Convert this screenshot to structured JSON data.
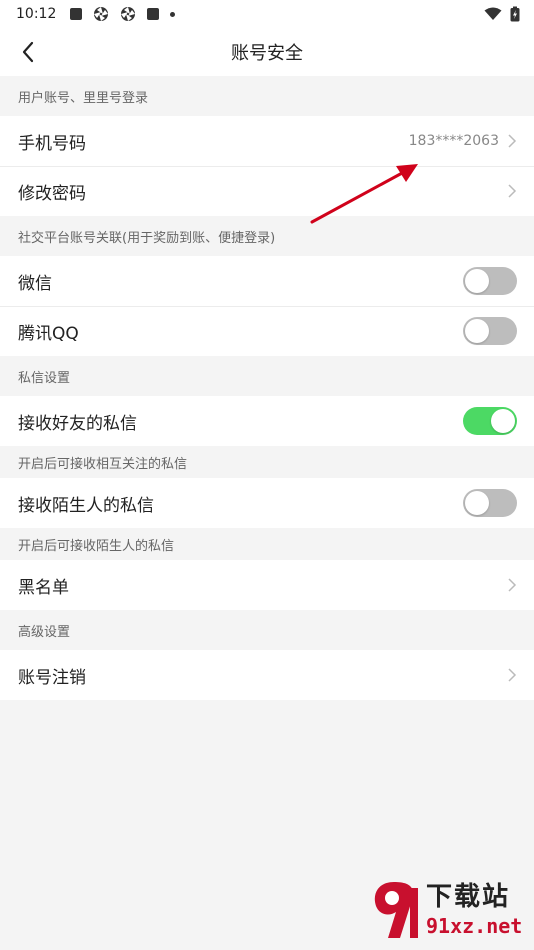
{
  "status_bar": {
    "time": "10:12"
  },
  "nav": {
    "title": "账号安全"
  },
  "sections": {
    "login": {
      "header": "用户账号、里里号登录",
      "phone": {
        "label": "手机号码",
        "value": "183****2063"
      },
      "password": {
        "label": "修改密码"
      }
    },
    "social": {
      "header": "社交平台账号关联(用于奖励到账、便捷登录)",
      "wechat": {
        "label": "微信",
        "enabled": false
      },
      "qq": {
        "label": "腾讯QQ",
        "enabled": false
      }
    },
    "messages": {
      "header": "私信设置",
      "friends": {
        "label": "接收好友的私信",
        "enabled": true
      },
      "friends_note": "开启后可接收相互关注的私信",
      "strangers": {
        "label": "接收陌生人的私信",
        "enabled": false
      },
      "strangers_note": "开启后可接收陌生人的私信",
      "blacklist": {
        "label": "黑名单"
      }
    },
    "advanced": {
      "header": "高级设置",
      "deactivate": {
        "label": "账号注销"
      }
    }
  },
  "watermark": {
    "title": "下载站",
    "domain": "91xz.net"
  },
  "colors": {
    "toggle_on": "#4cd964",
    "toggle_off": "#bdbdbd",
    "annotation": "#d0021b"
  }
}
